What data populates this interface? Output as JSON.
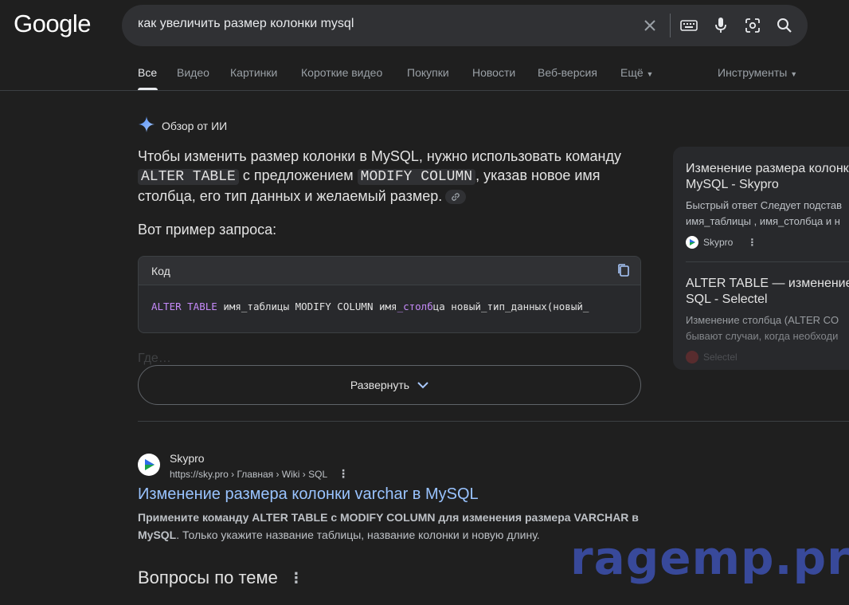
{
  "logo": "Google",
  "search": {
    "query": "как увеличить размер колонки mysql"
  },
  "tabs": [
    {
      "label": "Все"
    },
    {
      "label": "Видео"
    },
    {
      "label": "Картинки"
    },
    {
      "label": "Короткие видео"
    },
    {
      "label": "Покупки"
    },
    {
      "label": "Новости"
    },
    {
      "label": "Веб-версия"
    },
    {
      "label": "Ещё"
    }
  ],
  "tools_label": "Инструменты",
  "ai_overview": {
    "heading": "Обзор от ИИ",
    "text_1": "Чтобы изменить размер колонки в MySQL, нужно использовать команду ",
    "code_1": "ALTER TABLE",
    "text_2": " с предложением ",
    "code_2": "MODIFY COLUMN",
    "text_3": ", указав новое имя столбца, его тип данных и желаемый размер.",
    "example_label": "Вот пример запроса:",
    "code_block": {
      "header": "Код",
      "kw_1": "ALTER TABLE",
      "rest_1": " имя_таблицы MODIFY COLUMN имя",
      "kw_2": "_столб",
      "rest_2": "ца новый_тип_данных(новый_"
    },
    "faded_text": "Где…",
    "expand_label": "Развернуть"
  },
  "side_panel": {
    "items": [
      {
        "title_1": "Изменение размера колонки",
        "title_2": "MySQL - Skypro",
        "snippet_1": "Быстрый ответ Следует подстав",
        "snippet_2": "имя_таблицы , имя_столбца и н",
        "source": "Skypro"
      },
      {
        "title_1": "ALTER TABLE — изменение",
        "title_2": "SQL - Selectel",
        "snippet_1": "Изменение столбца (ALTER CO",
        "snippet_2": "бывают случаи, когда необходи",
        "source": "Selectel"
      }
    ]
  },
  "result": {
    "site": "Skypro",
    "url": "https://sky.pro › Главная › Wiki › SQL",
    "title": "Изменение размера колонки varchar в MySQL",
    "snippet_bold": "Примените команду ALTER TABLE с MODIFY COLUMN для изменения размера VARCHAR в MySQL",
    "snippet_rest": ". Только укажите название таблицы, название колонки и новую длину."
  },
  "questions_heading": "Вопросы по теме",
  "watermark": "ragemp.pro",
  "colors": {
    "background": "#1f1f1f",
    "link": "#99c3ff",
    "accent_kw": "#c58af9"
  }
}
